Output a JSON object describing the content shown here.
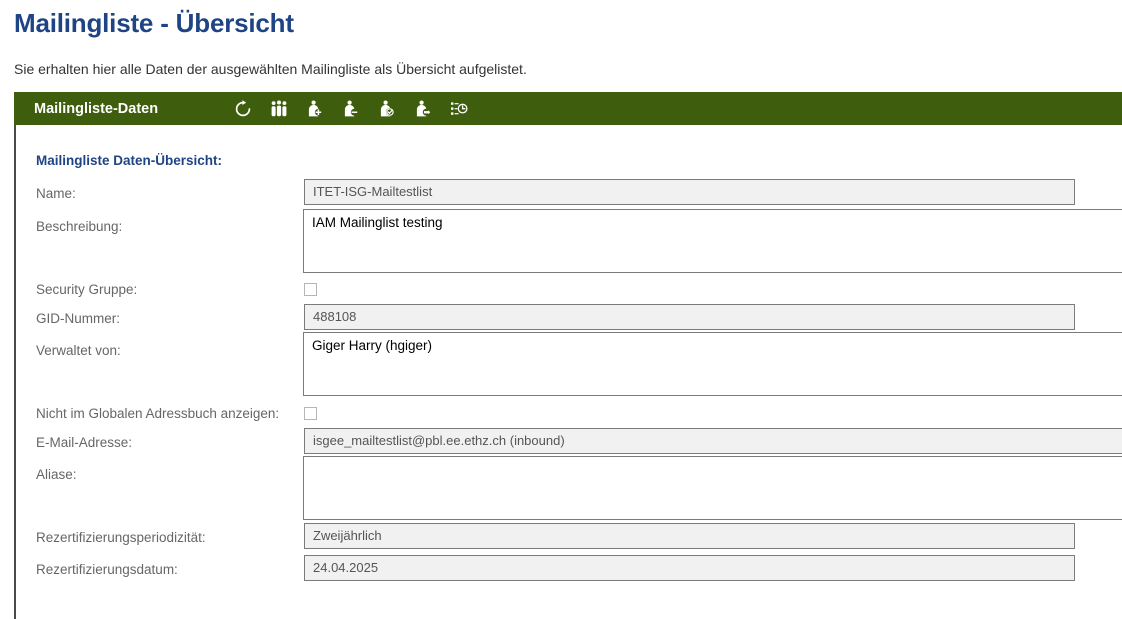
{
  "page": {
    "title": "Mailingliste - Übersicht",
    "subtitle": "Sie erhalten hier alle Daten der ausgewählten Mailingliste als Übersicht aufgelistet."
  },
  "panel": {
    "header_title": "Mailingliste-Daten",
    "section_title": "Mailingliste Daten-Übersicht:",
    "accent_color": "#3e5e0e",
    "title_color": "#1f4485",
    "toolbar": [
      {
        "name": "refresh-icon",
        "label": "Aktualisieren"
      },
      {
        "name": "members-group-icon",
        "label": "Mitglieder"
      },
      {
        "name": "add-member-icon",
        "label": "Mitglied hinzufügen"
      },
      {
        "name": "remove-member-icon",
        "label": "Mitglied entfernen"
      },
      {
        "name": "certify-member-icon",
        "label": "Rezertifizieren"
      },
      {
        "name": "edit-member-icon",
        "label": "Mitglied bearbeiten"
      },
      {
        "name": "history-log-icon",
        "label": "Verlauf"
      }
    ]
  },
  "fields": {
    "name": {
      "label": "Name:",
      "value": "ITET-ISG-Mailtestlist"
    },
    "beschreibung": {
      "label": "Beschreibung:",
      "value": "IAM Mailinglist testing"
    },
    "security_gruppe": {
      "label": "Security Gruppe:",
      "checked": false
    },
    "gid_nummer": {
      "label": "GID-Nummer:",
      "value": "488108"
    },
    "verwaltet_von": {
      "label": "Verwaltet von:",
      "value": "Giger Harry (hgiger)"
    },
    "nicht_im_gab": {
      "label": "Nicht im Globalen Adressbuch anzeigen:",
      "checked": false
    },
    "email_adresse": {
      "label": "E-Mail-Adresse:",
      "value": "isgee_mailtestlist@pbl.ee.ethz.ch (inbound)"
    },
    "aliase": {
      "label": "Aliase:",
      "value": ""
    },
    "rezert_periodizitaet": {
      "label": "Rezertifizierungsperiodizität:",
      "value": "Zweijährlich"
    },
    "rezert_datum": {
      "label": "Rezertifizierungsdatum:",
      "value": "24.04.2025"
    }
  }
}
